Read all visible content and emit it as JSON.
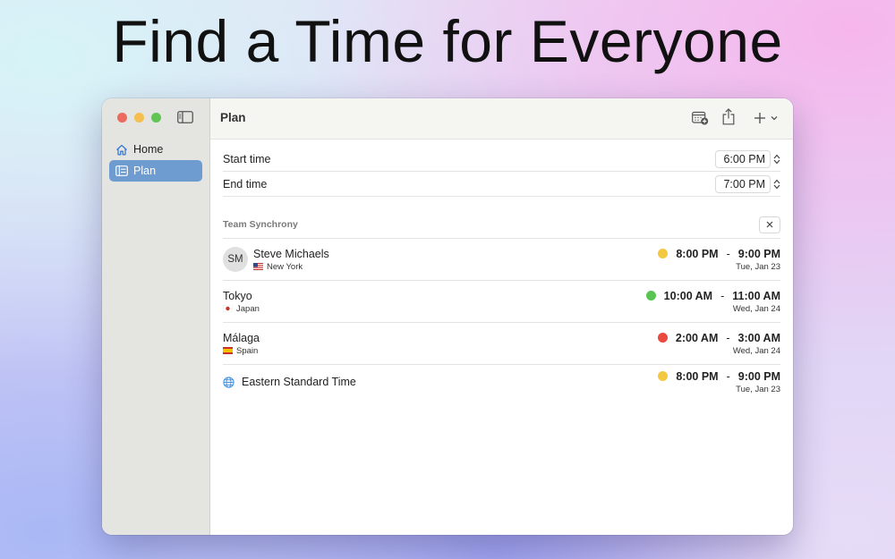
{
  "headline": "Find a Time for Everyone",
  "sidebar": {
    "items": [
      {
        "label": "Home",
        "icon": "house-icon",
        "active": false
      },
      {
        "label": "Plan",
        "icon": "plan-icon",
        "active": true
      }
    ]
  },
  "toolbar": {
    "title": "Plan",
    "buttons": [
      "calendar-add-icon",
      "share-icon",
      "plus-icon",
      "chevron-down-icon"
    ]
  },
  "times": {
    "start_label": "Start time",
    "start_value": "6:00 PM",
    "end_label": "End time",
    "end_value": "7:00 PM"
  },
  "team": {
    "title": "Team Synchrony",
    "rows": [
      {
        "name": "Steve Michaels",
        "initials": "SM",
        "location": "New York",
        "flag": "us",
        "status_color": "#f5c842",
        "start": "8:00 PM",
        "end": "9:00 PM",
        "date": "Tue, Jan 23"
      },
      {
        "name": "Tokyo",
        "location": "Japan",
        "flag": "jp",
        "status_color": "#5ac452",
        "start": "10:00 AM",
        "end": "11:00 AM",
        "date": "Wed, Jan 24"
      },
      {
        "name": "Málaga",
        "location": "Spain",
        "flag": "es",
        "status_color": "#e9493e",
        "start": "2:00 AM",
        "end": "3:00 AM",
        "date": "Wed, Jan 24"
      }
    ],
    "timezone": {
      "name": "Eastern Standard Time",
      "icon": "globe-icon",
      "status_color": "#f5c842",
      "start": "8:00 PM",
      "end": "9:00 PM",
      "date": "Tue, Jan 23"
    }
  },
  "colors": {
    "accent": "#6e9bd0",
    "dash": "-"
  }
}
